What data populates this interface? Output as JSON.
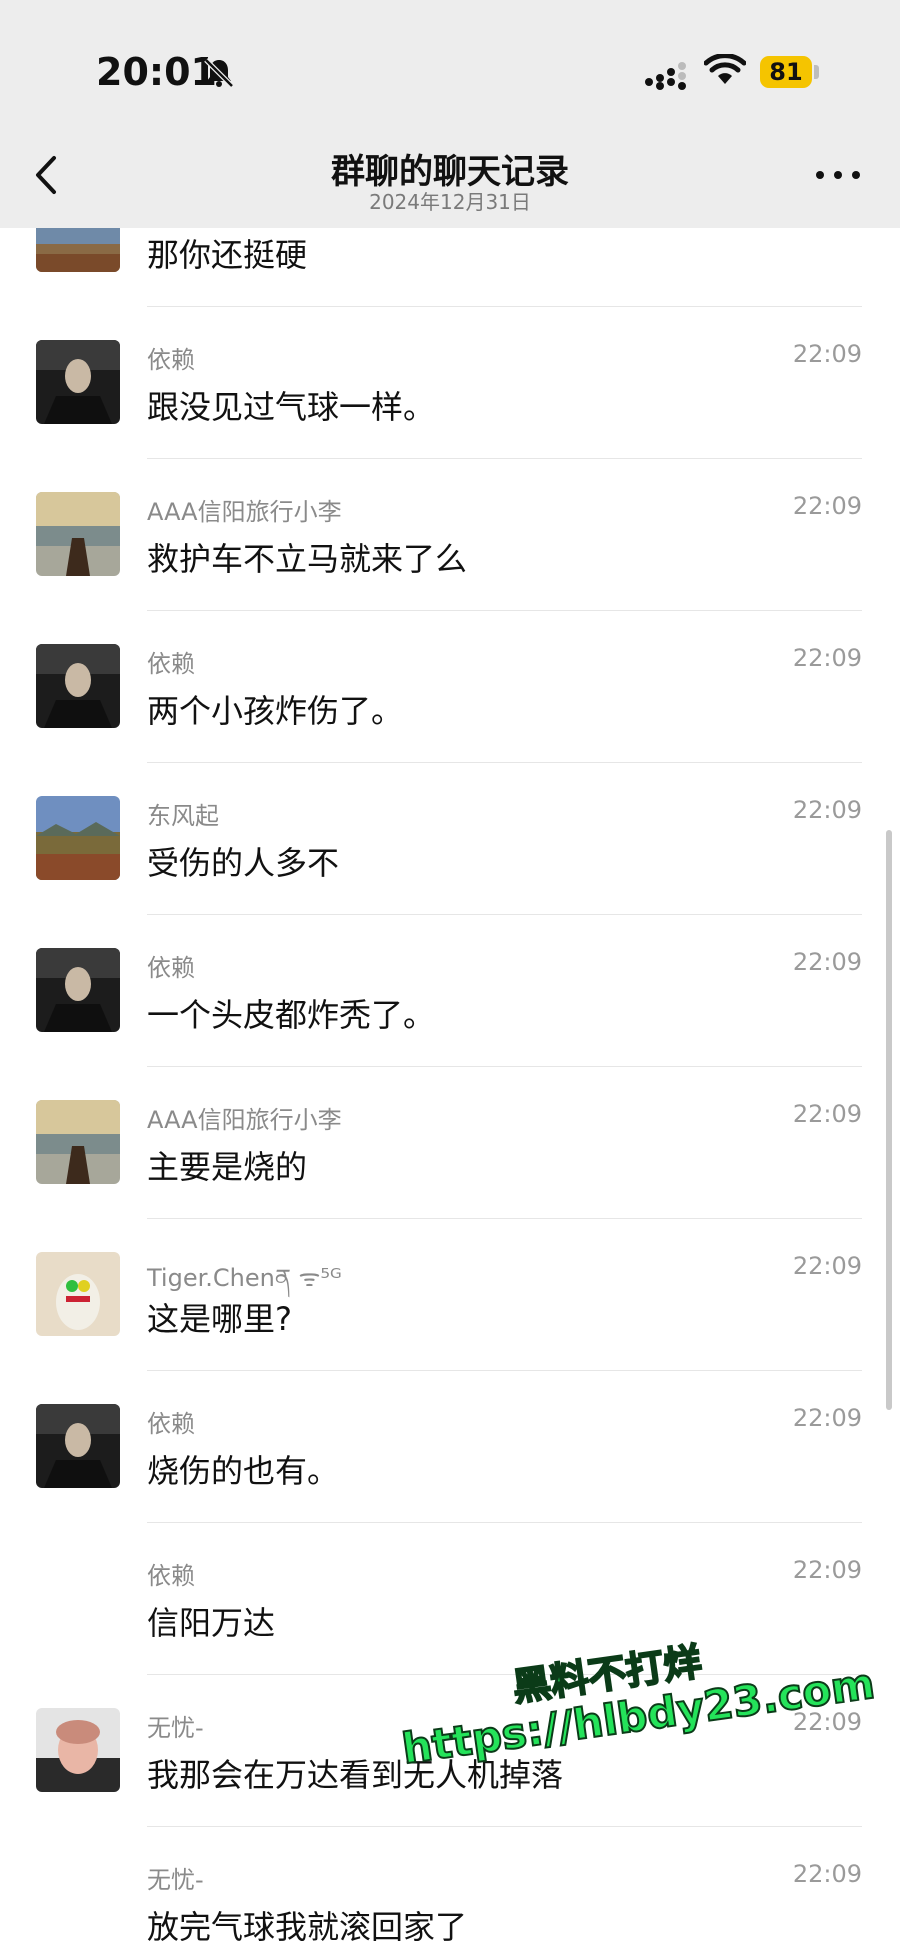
{
  "status_bar": {
    "time": "20:01",
    "battery": "81"
  },
  "header": {
    "title": "群聊的聊天记录",
    "subtitle": "2024年12月31日"
  },
  "messages": [
    {
      "sender": "",
      "time": "",
      "text": "那你还挺硬",
      "avatar": "landscape"
    },
    {
      "sender": "依赖",
      "time": "22:09",
      "text": "跟没见过气球一样。",
      "avatar": "portrait-man"
    },
    {
      "sender": "AAA信阳旅行小李",
      "time": "22:09",
      "text": "救护车不立马就来了么",
      "avatar": "horse-lake"
    },
    {
      "sender": "依赖",
      "time": "22:09",
      "text": "两个小孩炸伤了。",
      "avatar": "portrait-man"
    },
    {
      "sender": "东风起",
      "time": "22:09",
      "text": "受伤的人多不",
      "avatar": "landscape"
    },
    {
      "sender": "依赖",
      "time": "22:09",
      "text": "一个头皮都炸秃了。",
      "avatar": "portrait-man"
    },
    {
      "sender": "AAA信阳旅行小李",
      "time": "22:09",
      "text": "主要是烧的",
      "avatar": "horse-lake"
    },
    {
      "sender": "Tiger.Chenན ᯤ⁵ᴳ",
      "time": "22:09",
      "text": "这是哪里?",
      "avatar": "cartoon"
    },
    {
      "sender": "依赖",
      "time": "22:09",
      "text": "烧伤的也有。",
      "avatar": "portrait-man"
    },
    {
      "sender": "依赖",
      "time": "22:09",
      "text": "信阳万达",
      "avatar": "none"
    },
    {
      "sender": "无忧-",
      "time": "22:09",
      "text": "我那会在万达看到无人机掉落",
      "avatar": "photo-person"
    },
    {
      "sender": "无忧-",
      "time": "22:09",
      "text": "放完气球我就滚回家了",
      "avatar": "none"
    }
  ],
  "watermark": {
    "line1": "黑料不打烊",
    "line2": "https://hlbdy23.com"
  }
}
